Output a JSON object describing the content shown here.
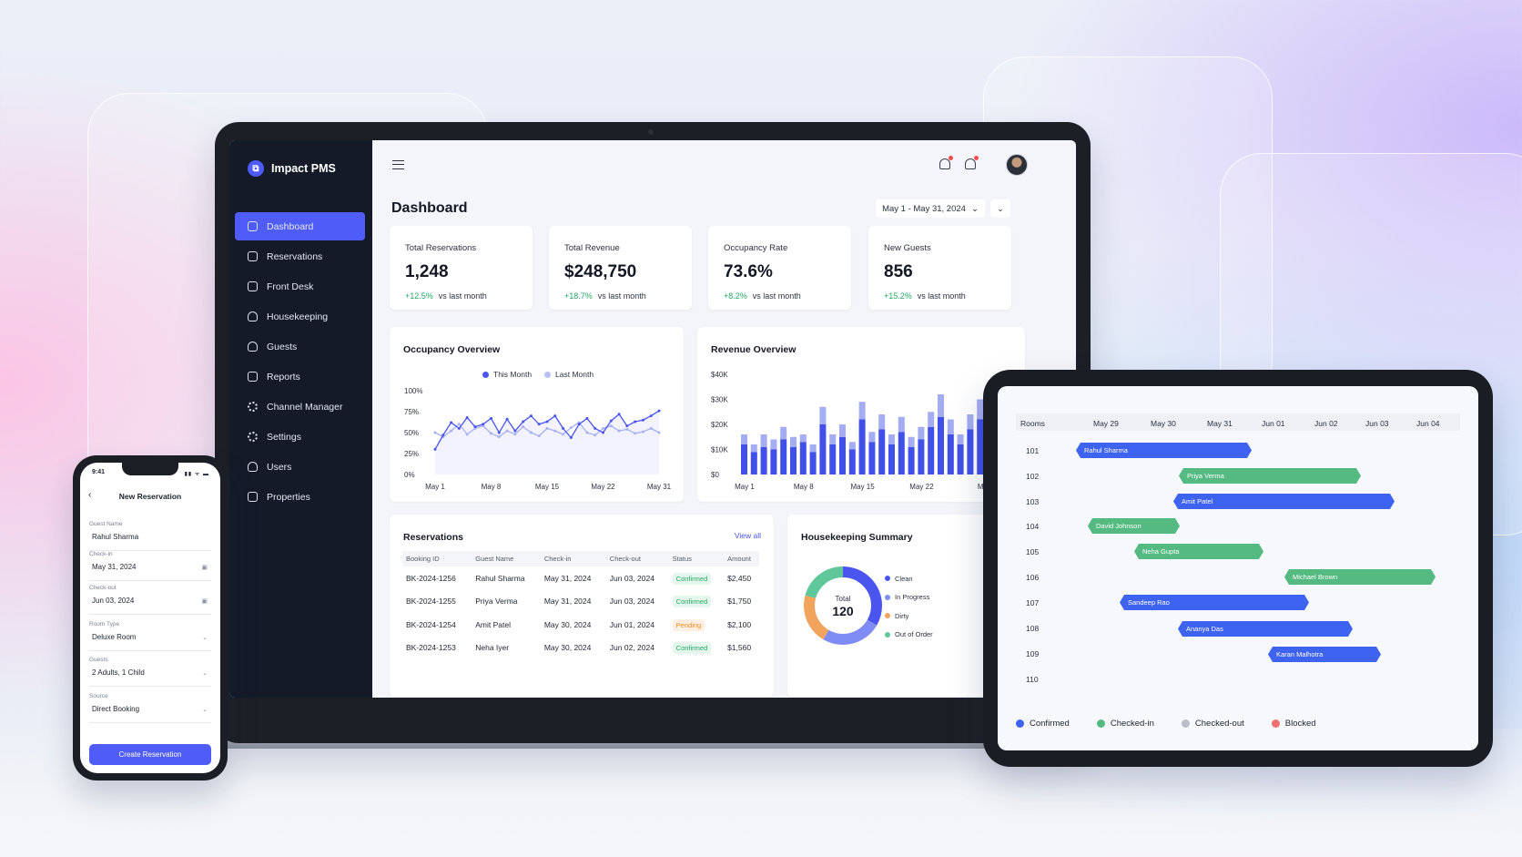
{
  "app": {
    "name": "Impact PMS"
  },
  "sidebar": {
    "items": [
      {
        "label": "Dashboard",
        "active": true
      },
      {
        "label": "Reservations"
      },
      {
        "label": "Front Desk"
      },
      {
        "label": "Housekeeping"
      },
      {
        "label": "Guests"
      },
      {
        "label": "Reports"
      },
      {
        "label": "Channel Manager"
      },
      {
        "label": "Settings"
      },
      {
        "label": "Users"
      },
      {
        "label": "Properties"
      }
    ]
  },
  "header": {
    "title": "Dashboard",
    "date_range": "May 1 - May 31, 2024",
    "date_caret": "⌄",
    "expand_caret": "⌄"
  },
  "stats": [
    {
      "label": "Total Reservations",
      "value": "1,248",
      "change": "+12.5%",
      "suffix": "vs last month"
    },
    {
      "label": "Total Revenue",
      "value": "$248,750",
      "change": "+18.7%",
      "suffix": "vs last month"
    },
    {
      "label": "Occupancy Rate",
      "value": "73.6%",
      "change": "+8.2%",
      "suffix": "vs last month"
    },
    {
      "label": "New Guests",
      "value": "856",
      "change": "+15.2%",
      "suffix": "vs last month"
    }
  ],
  "occupancy": {
    "title": "Occupancy Overview",
    "legend": [
      "This Month",
      "Last Month"
    ]
  },
  "revenue": {
    "title": "Revenue Overview"
  },
  "chart_data": [
    {
      "type": "line",
      "title": "Occupancy Overview",
      "x_ticks": [
        "May 1",
        "May 8",
        "May 15",
        "May 22",
        "May 31"
      ],
      "y_ticks": [
        "100%",
        "75%",
        "50%",
        "25%",
        "0%"
      ],
      "ylim": [
        0,
        100
      ],
      "legend": "top",
      "series": [
        {
          "name": "This Month",
          "color": "#4a55f0",
          "values": [
            30,
            47,
            62,
            55,
            68,
            57,
            60,
            67,
            50,
            66,
            52,
            63,
            70,
            60,
            63,
            70,
            55,
            44,
            60,
            67,
            55,
            50,
            64,
            72,
            58,
            63,
            65,
            70,
            76
          ]
        },
        {
          "name": "Last Month",
          "color": "#a9b1f2",
          "values": [
            50,
            45,
            52,
            60,
            48,
            55,
            58,
            49,
            45,
            52,
            48,
            57,
            50,
            46,
            55,
            52,
            48,
            56,
            62,
            50,
            47,
            55,
            58,
            52,
            54,
            49,
            51,
            55,
            50
          ]
        }
      ]
    },
    {
      "type": "bar",
      "title": "Revenue Overview",
      "x_ticks": [
        "May 1",
        "May 8",
        "May 15",
        "May 22",
        "M"
      ],
      "y_ticks": [
        "$40K",
        "$30K",
        "$20K",
        "$10K",
        "$0"
      ],
      "ylim": [
        0,
        40000
      ],
      "stacked": true,
      "series": [
        {
          "name": "Base",
          "color": "#4050e8",
          "values": [
            12000,
            9000,
            11000,
            10000,
            14000,
            11000,
            13000,
            9000,
            20000,
            12000,
            15000,
            10000,
            22000,
            13000,
            18000,
            12000,
            17000,
            11000,
            14000,
            19000,
            23000,
            16000,
            12000,
            18000,
            22000,
            14000,
            17000,
            20000
          ]
        },
        {
          "name": "Extra",
          "color": "#a4acf2",
          "values": [
            4000,
            3000,
            5000,
            4000,
            5000,
            4000,
            3000,
            3000,
            7000,
            4000,
            5000,
            3000,
            7000,
            4000,
            6000,
            4000,
            6000,
            4000,
            5000,
            6000,
            9000,
            6000,
            4000,
            6000,
            8000,
            5000,
            6000,
            7000
          ]
        }
      ]
    },
    {
      "type": "pie",
      "title": "Housekeeping Summary",
      "center_label": "Total",
      "center_value": "120",
      "slices": [
        {
          "label": "Clean",
          "color": "#4a55f0",
          "value": 40
        },
        {
          "label": "In Progress",
          "color": "#7f8cf5",
          "value": 30
        },
        {
          "label": "Dirty",
          "color": "#f2a35c",
          "value": 25
        },
        {
          "label": "Out of Order",
          "color": "#5fc79a",
          "value": 25
        }
      ]
    }
  ],
  "reservations": {
    "title": "Reservations",
    "view_all": "View all",
    "columns": [
      "Booking ID",
      "Guest Name",
      "Check-in",
      "Check-out",
      "Status",
      "Amount"
    ],
    "rows": [
      [
        "BK-2024-1256",
        "Rahul Sharma",
        "May 31, 2024",
        "Jun 03, 2024",
        "Confirmed",
        "$2,450"
      ],
      [
        "BK-2024-1255",
        "Priya Verma",
        "May 31, 2024",
        "Jun 03, 2024",
        "Confirmed",
        "$1,750"
      ],
      [
        "BK-2024-1254",
        "Amit Patel",
        "May 30, 2024",
        "Jun 01, 2024",
        "Pending",
        "$2,100"
      ],
      [
        "BK-2024-1253",
        "Neha Iyer",
        "May 30, 2024",
        "Jun 02, 2024",
        "Confirmed",
        "$1,560"
      ]
    ]
  },
  "housekeeping": {
    "title": "Housekeeping Summary",
    "total_label": "Total",
    "total_value": "120",
    "legend": [
      "Clean",
      "In Progress",
      "Dirty",
      "Out of Order"
    ]
  },
  "tablet": {
    "rooms_label": "Rooms",
    "dates": [
      "May 29",
      "May 30",
      "May 31",
      "Jun 01",
      "Jun 02",
      "Jun 03",
      "Jun 04"
    ],
    "rooms": [
      "101",
      "102",
      "103",
      "104",
      "105",
      "106",
      "107",
      "108",
      "109",
      "110"
    ],
    "bookings": [
      {
        "guest": "Rahul Sharma",
        "room": "101",
        "status": "Confirmed"
      },
      {
        "guest": "Priya Verma",
        "room": "102",
        "status": "Checked-in"
      },
      {
        "guest": "Amit Patel",
        "room": "103",
        "status": "Confirmed"
      },
      {
        "guest": "David Johnson",
        "room": "104",
        "status": "Checked-in"
      },
      {
        "guest": "Neha Gupta",
        "room": "105",
        "status": "Checked-in"
      },
      {
        "guest": "Michael Brown",
        "room": "106",
        "status": "Checked-in"
      },
      {
        "guest": "Sandeep Rao",
        "room": "107",
        "status": "Confirmed"
      },
      {
        "guest": "Ananya Das",
        "room": "108",
        "status": "Confirmed"
      },
      {
        "guest": "Karan Malhotra",
        "room": "109",
        "status": "Confirmed"
      }
    ],
    "legend": [
      {
        "label": "Confirmed",
        "color": "#3f63f1"
      },
      {
        "label": "Checked-in",
        "color": "#54ba82"
      },
      {
        "label": "Checked-out",
        "color": "#b9bdc8"
      },
      {
        "label": "Blocked",
        "color": "#f07070"
      }
    ]
  },
  "phone": {
    "time": "9:41",
    "status_icons": "▮▮ ᯤ ▬",
    "back": "‹",
    "title": "New Reservation",
    "fields": [
      {
        "label": "Guest Name",
        "value": "Rahul Sharma",
        "icon": ""
      },
      {
        "label": "Check-in",
        "value": "May 31, 2024",
        "icon": "▣"
      },
      {
        "label": "Check-out",
        "value": "Jun 03, 2024",
        "icon": "▣"
      },
      {
        "label": "Room Type",
        "value": "Deluxe Room",
        "icon": "⌄"
      },
      {
        "label": "Guests",
        "value": "2 Adults, 1 Child",
        "icon": "⌄"
      },
      {
        "label": "Source",
        "value": "Direct Booking",
        "icon": "⌄"
      }
    ],
    "submit": "Create Reservation"
  },
  "colors": {
    "accent": "#4f5cf8",
    "sidebar": "#141a28",
    "positive": "#22a866",
    "pending": "#f08a24"
  }
}
